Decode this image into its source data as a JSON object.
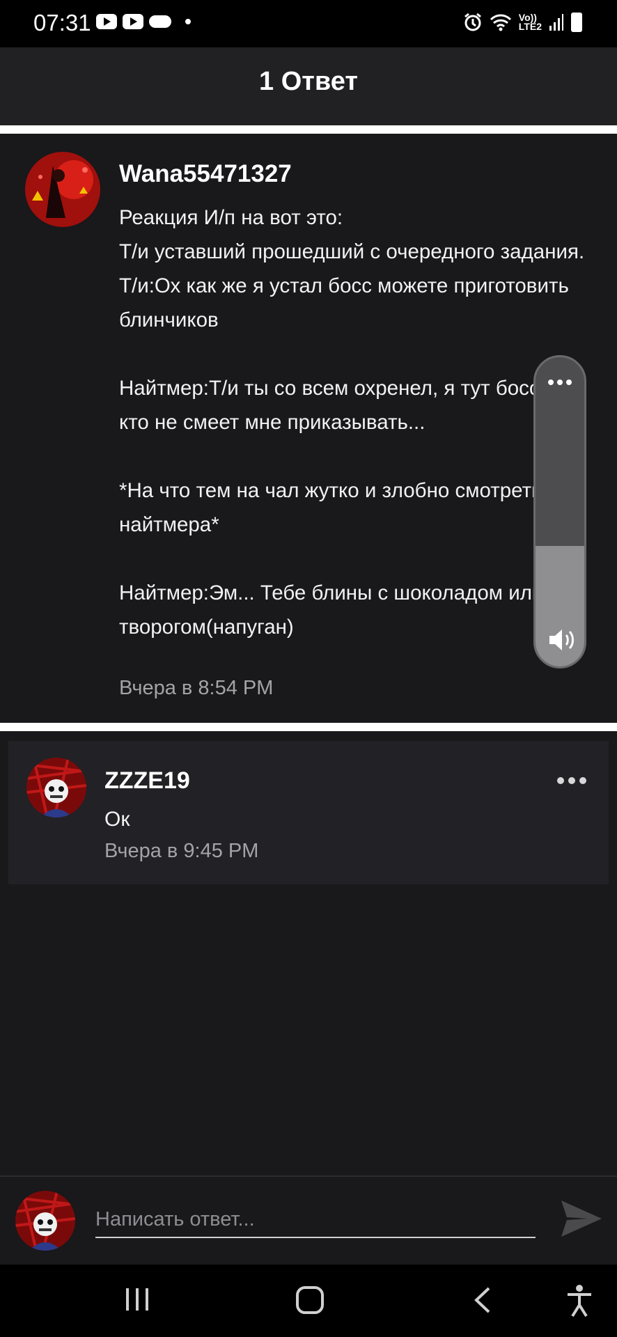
{
  "status_bar": {
    "time": "07:31",
    "left_icons": [
      "youtube-icon",
      "youtube-icon",
      "cloud-icon",
      "dot-icon"
    ],
    "right_icons": [
      "alarm-icon",
      "wifi-icon",
      "volte-lte2-icon",
      "signal-icon",
      "battery-icon"
    ],
    "volte_label": "Vo))",
    "lte_label": "LTE2"
  },
  "header": {
    "title": "1 Ответ"
  },
  "main_comment": {
    "username": "Wana55471327",
    "text": "Реакция И/п на вот это:\nТ/и уставший прошедший с очередного задания.\nТ/и:Ох как же я устал босс можете приготовить блинчиков\n\nНайтмер:Т/и ты со всем охренел, я тут босс и не кто не смеет мне приказывать...\n\n*На что тем на чал жутко и злобно смотреть на найтмера*\n\nНайтмер:Эм... Тебе блины с шоколадом или творогом(напуган)",
    "timestamp": "Вчера в 8:54 PM"
  },
  "reply_comment": {
    "username": "ZZZE19",
    "text": "Ок",
    "timestamp": "Вчера в 9:45 PM"
  },
  "volume_overlay": {
    "level": 0.39
  },
  "reply_bar": {
    "placeholder": "Написать ответ..."
  },
  "nav_bar": {
    "items": [
      "recent-apps-icon",
      "home-icon",
      "back-icon",
      "accessibility-icon"
    ]
  },
  "colors": {
    "background": "#19181b",
    "header": "#212023",
    "reply_card": "#222125",
    "muted_text": "#a4a3a8"
  }
}
